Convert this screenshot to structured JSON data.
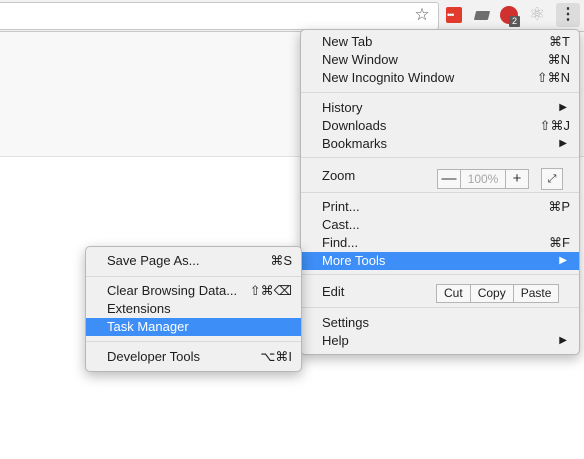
{
  "toolbar": {
    "bookmark_icon": "star-icon",
    "menu_icon": "vertical-dots-icon",
    "extension_badge": "2"
  },
  "main_menu": {
    "new_tab": {
      "label": "New Tab",
      "shortcut": "⌘T"
    },
    "new_window": {
      "label": "New Window",
      "shortcut": "⌘N"
    },
    "new_incognito": {
      "label": "New Incognito Window",
      "shortcut": "⇧⌘N"
    },
    "history": {
      "label": "History"
    },
    "downloads": {
      "label": "Downloads",
      "shortcut": "⇧⌘J"
    },
    "bookmarks": {
      "label": "Bookmarks"
    },
    "zoom": {
      "label": "Zoom",
      "minus": "—",
      "value": "100%",
      "plus": "+",
      "fullscreen": "⤢"
    },
    "print": {
      "label": "Print...",
      "shortcut": "⌘P"
    },
    "cast": {
      "label": "Cast..."
    },
    "find": {
      "label": "Find...",
      "shortcut": "⌘F"
    },
    "more_tools": {
      "label": "More Tools"
    },
    "edit": {
      "label": "Edit",
      "cut": "Cut",
      "copy": "Copy",
      "paste": "Paste"
    },
    "settings": {
      "label": "Settings"
    },
    "help": {
      "label": "Help"
    },
    "submenu_arrow": "▶"
  },
  "sub_menu": {
    "save_page": {
      "label": "Save Page As...",
      "shortcut": "⌘S"
    },
    "clear_data": {
      "label": "Clear Browsing Data...",
      "shortcut": "⇧⌘⌫"
    },
    "extensions": {
      "label": "Extensions"
    },
    "task_manager": {
      "label": "Task Manager"
    },
    "developer_tools": {
      "label": "Developer Tools",
      "shortcut": "⌥⌘I"
    }
  },
  "colors": {
    "highlight": "#3d8ef6",
    "menu_bg": "#f0f0f0"
  }
}
